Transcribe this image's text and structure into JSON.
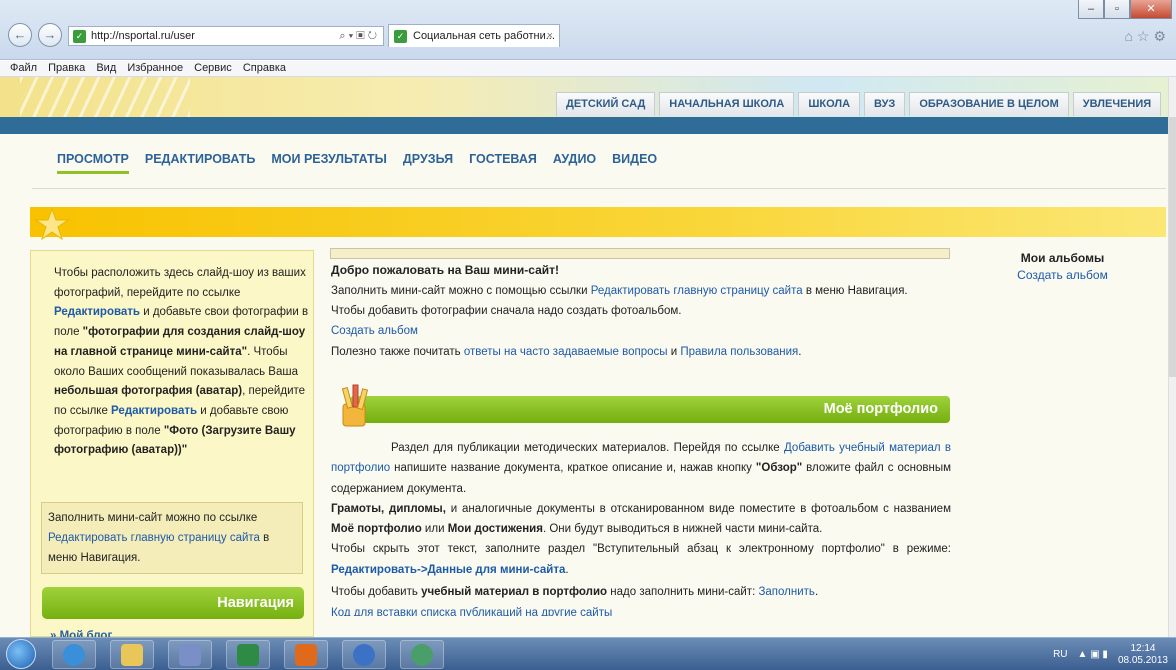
{
  "browser": {
    "url": "http://nsportal.ru/user",
    "address_controls": "⌕ ▾ ▣ ↻",
    "tab_title": "Социальная сеть работни...",
    "tab_close": "×",
    "menu": [
      "Файл",
      "Правка",
      "Вид",
      "Избранное",
      "Сервис",
      "Справка"
    ]
  },
  "site": {
    "categories": [
      "ДЕТСКИЙ САД",
      "НАЧАЛЬНАЯ ШКОЛА",
      "ШКОЛА",
      "ВУЗ",
      "ОБРАЗОВАНИЕ В ЦЕЛОМ",
      "УВЛЕЧЕНИЯ"
    ],
    "subnav": [
      "ПРОСМОТР",
      "РЕДАКТИРОВАТЬ",
      "МОИ РЕЗУЛЬТАТЫ",
      "ДРУЗЬЯ",
      "ГОСТЕВАЯ",
      "АУДИО",
      "ВИДЕО"
    ]
  },
  "left": {
    "t1": "Чтобы расположить здесь слайд-шоу из ваших фотографий, перейдите по ссылке ",
    "link1": "Редактировать",
    "t2": " и добавьте свои фотографии в поле ",
    "b1": "\"фотографии для создания слайд-шоу на главной странице мини-сайта\"",
    "t3": ". Чтобы около Ваших сообщений показывалась Ваша ",
    "b2": "небольшая фотография (аватар)",
    "t4": ", перейдите по ссылке ",
    "link2": "Редактировать",
    "t5": " и добавьте свою фотографию в поле ",
    "b3": "\"Фото (Загрузите Вашу фотографию (аватар))\"",
    "note_t1": "Заполнить мини-сайт можно по ссылке ",
    "note_link": "Редактировать главную страницу сайта",
    "note_t2": " в меню Навигация.",
    "nav_title": "Навигация",
    "blog": "» Мой блог"
  },
  "main": {
    "welcome": "Добро пожаловать на Ваш мини-сайт!",
    "l1a": "Заполнить мини-сайт можно с помощью ссылки ",
    "l1link": "Редактировать главную страницу сайта",
    "l1b": " в меню Навигация.",
    "l2": "Чтобы добавить фотографии сначала надо создать фотоальбом.",
    "l3link": "Создать альбом",
    "l4a": "Полезно также почитать ",
    "l4link1": "ответы на часто задаваемые вопросы",
    "l4b": " и ",
    "l4link2": "Правила пользования",
    "l4c": ".",
    "portfolio_title": "Моё портфолио",
    "p1a": "Раздел для публикации методических материалов. Перейдя по ссылке ",
    "p1link": "Добавить учебный материал в портфолио",
    "p1b": " напишите название документа, краткое описание и, нажав кнопку ",
    "p1bold": "\"Обзор\"",
    "p1c": " вложите файл с основным содержанием документа.",
    "p2bold": "Грамоты, дипломы,",
    "p2a": " и аналогичные документы в отсканированном виде поместите в фотоальбом с названием ",
    "p2bold2": "Моё портфолио",
    "p2b": " или ",
    "p2bold3": "Мои достижения",
    "p2c": ". Они будут выводиться в нижней части мини-сайта.",
    "p3a": "Чтобы скрыть этот текст, заполните раздел \"Вступительный абзац к электронному портфолио\" в режиме: ",
    "p3link": "Редактировать->Данные для мини-сайта",
    "p3b": ".",
    "p4a": "Чтобы добавить ",
    "p4bold": "учебный материал в портфолио",
    "p4b": " надо заполнить мини-сайт: ",
    "p4link": "Заполнить",
    "p4c": ".",
    "p5link": "Код для вставки списка публикаций на другие сайты"
  },
  "right": {
    "title": "Мои альбомы",
    "link": "Создать альбом"
  },
  "taskbar": {
    "lang": "RU",
    "time": "12:14",
    "date": "08.05.2013"
  }
}
